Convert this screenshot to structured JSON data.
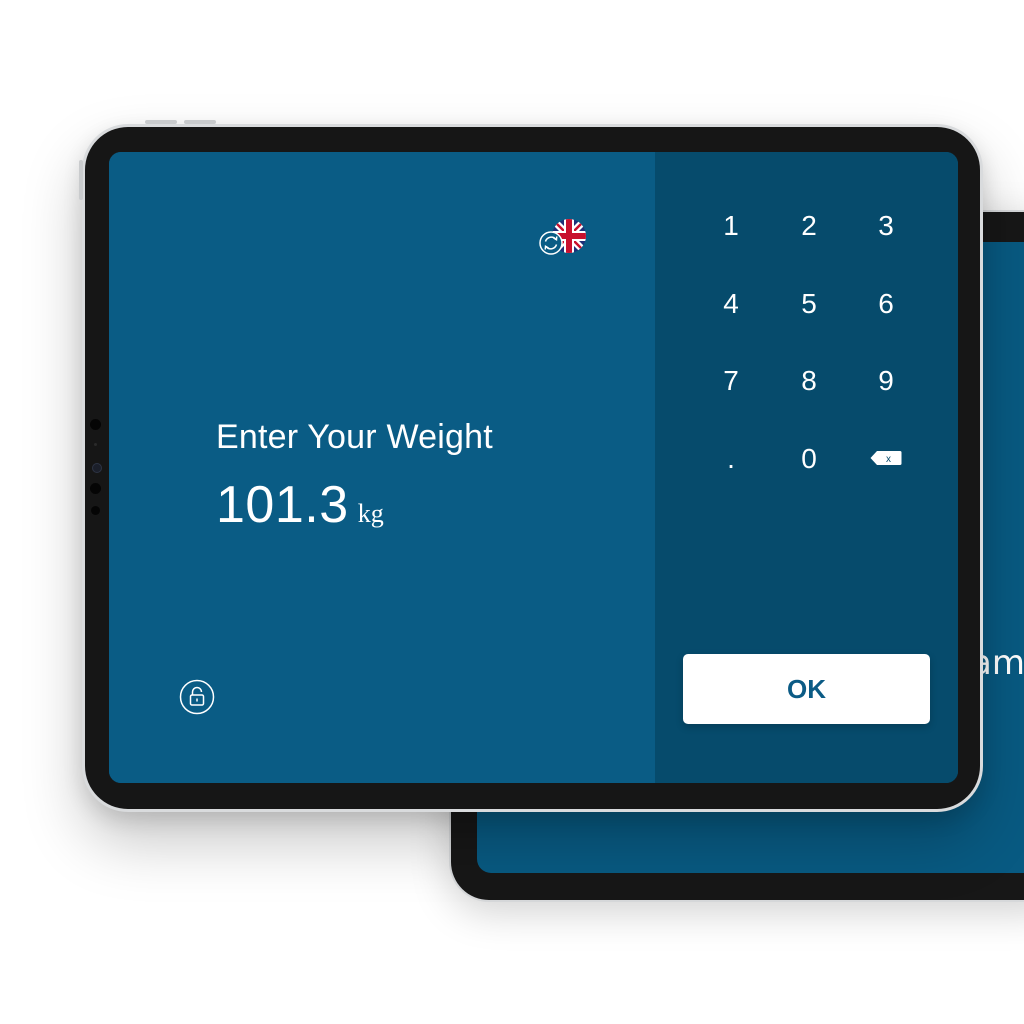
{
  "back_tablet": {
    "text_fragment": "am"
  },
  "screen": {
    "language_icon": "uk-flag-refresh-icon",
    "prompt": "Enter Your Weight",
    "weight_value": "101.3",
    "weight_unit": "kg",
    "lock_icon": "lock-icon"
  },
  "keypad": {
    "keys": [
      "1",
      "2",
      "3",
      "4",
      "5",
      "6",
      "7",
      "8",
      "9",
      ".",
      "0"
    ],
    "backspace_label": "x",
    "ok_label": "OK"
  },
  "colors": {
    "left_pane": "#0a5c85",
    "right_pane": "#064b6c",
    "flag_blue": "#1e2f78",
    "flag_red": "#c8102e",
    "ok_text": "#0b5b85"
  }
}
